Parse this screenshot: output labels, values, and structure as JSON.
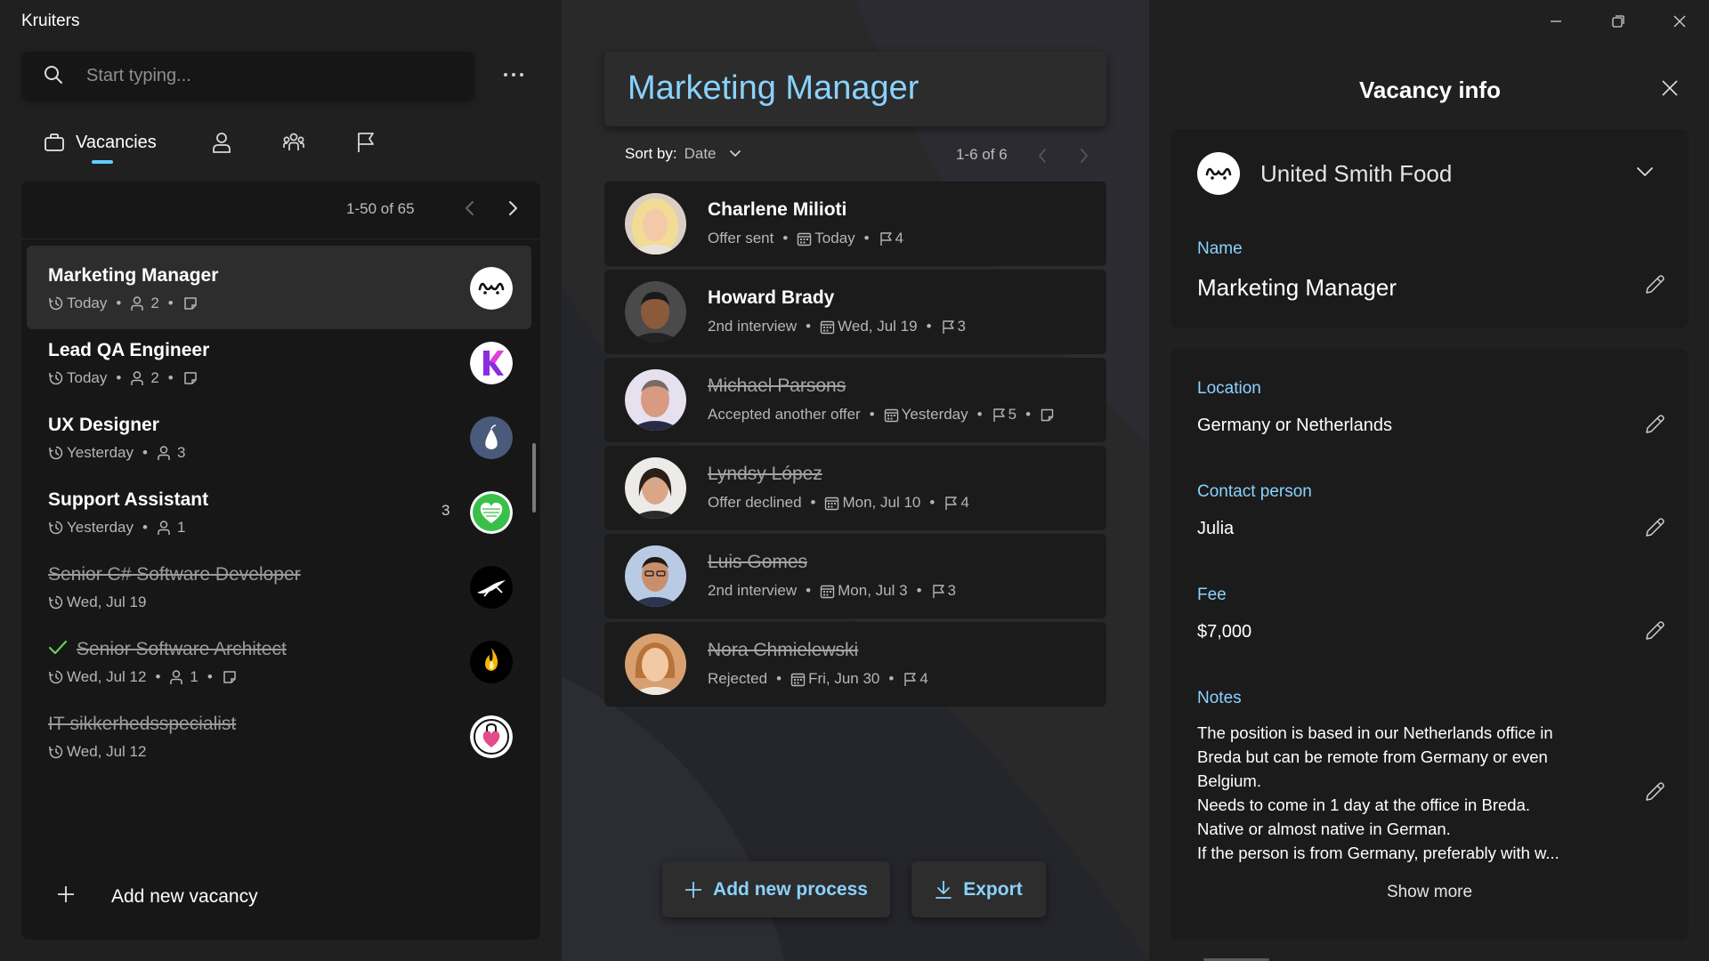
{
  "app": {
    "title": "Kruiters"
  },
  "search": {
    "placeholder": "Start typing..."
  },
  "nav": {
    "tabs": [
      {
        "label": "Vacancies",
        "icon": "briefcase-icon",
        "active": true
      },
      {
        "label": "",
        "icon": "person-icon"
      },
      {
        "label": "",
        "icon": "people-icon"
      },
      {
        "label": "",
        "icon": "flag-icon"
      }
    ]
  },
  "vacancy_list": {
    "pagination": "1-50 of 65",
    "items": [
      {
        "title": "Marketing Manager",
        "date": "Today",
        "candidates": "2",
        "has_notes": true,
        "selected": true,
        "struck": false,
        "logo": "united-smith-food-logo"
      },
      {
        "title": "Lead QA Engineer",
        "date": "Today",
        "candidates": "2",
        "has_notes": true,
        "struck": false,
        "logo": "k-logo"
      },
      {
        "title": "UX Designer",
        "date": "Yesterday",
        "candidates": "3",
        "struck": false,
        "logo": "pear-logo"
      },
      {
        "title": "Support Assistant",
        "date": "Yesterday",
        "candidates": "1",
        "badge": "3",
        "struck": false,
        "logo": "green-heart-logo"
      },
      {
        "title": "Senior C# Software Developer",
        "date": "Wed, Jul 19",
        "struck": true,
        "logo": "leaping-animal-logo"
      },
      {
        "title": "Senior Software Architect",
        "date": "Wed, Jul 12",
        "candidates": "1",
        "has_notes": true,
        "struck": true,
        "completed": true,
        "logo": "flame-logo"
      },
      {
        "title": "IT-sikkerhedsspecialist",
        "date": "Wed, Jul 12",
        "struck": true,
        "logo": "heart-lock-logo"
      }
    ],
    "add_label": "Add new vacancy"
  },
  "process_panel": {
    "title": "Marketing Manager",
    "sort_label": "Sort by:",
    "sort_value": "Date",
    "pagination": "1-6 of 6",
    "processes": [
      {
        "name": "Charlene Milioti",
        "status": "Offer sent",
        "date": "Today",
        "flags": "4",
        "struck": false
      },
      {
        "name": "Howard Brady",
        "status": "2nd interview",
        "date": "Wed, Jul 19",
        "flags": "3",
        "struck": false
      },
      {
        "name": "Michael Parsons",
        "status": "Accepted another offer",
        "date": "Yesterday",
        "flags": "5",
        "has_notes": true,
        "struck": true
      },
      {
        "name": "Lyndsy López",
        "status": "Offer declined",
        "date": "Mon, Jul 10",
        "flags": "4",
        "struck": true
      },
      {
        "name": "Luis Gomes",
        "status": "2nd interview",
        "date": "Mon, Jul 3",
        "flags": "3",
        "struck": true
      },
      {
        "name": "Nora Chmielewski",
        "status": "Rejected",
        "date": "Fri, Jun 30",
        "flags": "4",
        "struck": true
      }
    ],
    "add_process_label": "Add new process",
    "export_label": "Export"
  },
  "vacancy_info": {
    "title": "Vacancy info",
    "company": "United Smith Food",
    "name_label": "Name",
    "name": "Marketing Manager",
    "location_label": "Location",
    "location": "Germany or Netherlands",
    "contact_label": "Contact person",
    "contact": "Julia",
    "fee_label": "Fee",
    "fee": "$7,000",
    "notes_label": "Notes",
    "notes_lines": [
      "The position is based in our Netherlands office in",
      "Breda but can be remote from Germany or even",
      "Belgium.",
      "Needs to come in 1 day at the office in Breda.",
      "Native or almost native in German.",
      "If the person is from Germany, preferably with w..."
    ],
    "show_more_label": "Show more"
  },
  "colors": {
    "accent": "#8ad2ff",
    "tab_indicator": "#60cdff",
    "selected_row": "#2d2d2d",
    "card": "#1b1b1b",
    "check": "#6ccb5f"
  }
}
